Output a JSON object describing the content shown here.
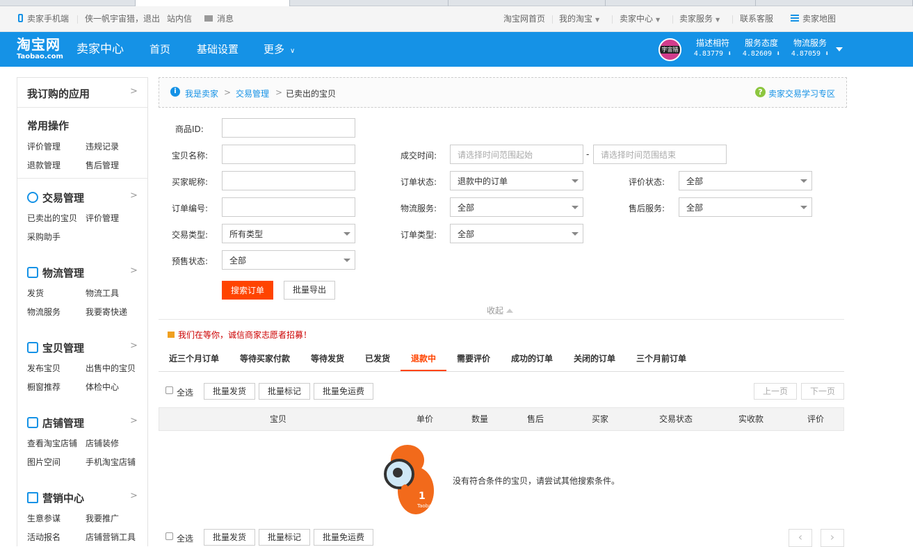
{
  "top_bar": {
    "mobile": "卖家手机端",
    "user": "侠一帆宇宙猎，退出",
    "inbox": "站内信",
    "messages": "消息",
    "taobao_home": "淘宝网首页",
    "my_taobao": "我的淘宝",
    "seller_center": "卖家中心",
    "seller_service": "卖家服务",
    "contact": "联系客服",
    "site_map": "卖家地图"
  },
  "header": {
    "logo_cn": "淘宝网",
    "logo_en": "Taobao.com",
    "title": "卖家中心",
    "nav": [
      "首页",
      "基础设置",
      "更多"
    ],
    "avatar_text": "宇宙猎",
    "stats": [
      {
        "label": "描述相符",
        "value": "4.83779"
      },
      {
        "label": "服务态度",
        "value": "4.82609"
      },
      {
        "label": "物流服务",
        "value": "4.87059"
      }
    ]
  },
  "sidebar": {
    "apps": "我订购的应用",
    "common": {
      "title": "常用操作",
      "links": [
        "评价管理",
        "违规记录",
        "退款管理",
        "售后管理"
      ]
    },
    "trade": {
      "title": "交易管理",
      "links": [
        "已卖出的宝贝",
        "评价管理",
        "采购助手"
      ]
    },
    "logistics": {
      "title": "物流管理",
      "links": [
        "发货",
        "物流工具",
        "物流服务",
        "我要寄快递"
      ]
    },
    "goods": {
      "title": "宝贝管理",
      "links": [
        "发布宝贝",
        "出售中的宝贝",
        "橱窗推荐",
        "体检中心"
      ]
    },
    "shop": {
      "title": "店铺管理",
      "links": [
        "查看淘宝店铺",
        "店铺装修",
        "图片空间",
        "手机淘宝店铺"
      ]
    },
    "marketing": {
      "title": "营销中心",
      "links": [
        "生意参谋",
        "我要推广",
        "活动报名",
        "店铺营销工具"
      ]
    }
  },
  "breadcrumb": {
    "items": [
      "我是卖家",
      "交易管理",
      "已卖出的宝贝"
    ],
    "separator": ">",
    "help": "卖家交易学习专区"
  },
  "form": {
    "item_id": "商品ID:",
    "item_name": "宝贝名称:",
    "buyer_nick": "买家昵称:",
    "order_no": "订单编号:",
    "trade_type": "交易类型:",
    "presale": "预售状态:",
    "deal_time": "成交时间:",
    "order_status": "订单状态:",
    "logistics": "物流服务:",
    "order_type": "订单类型:",
    "review_status": "评价状态:",
    "after_sale": "售后服务:",
    "time_start_ph": "请选择时间范围起始",
    "time_end_ph": "请选择时间范围结束",
    "dash": "-",
    "trade_type_val": "所有类型",
    "presale_val": "全部",
    "order_status_val": "退款中的订单",
    "logistics_val": "全部",
    "order_type_val": "全部",
    "review_status_val": "全部",
    "after_sale_val": "全部",
    "search_btn": "搜索订单",
    "export_btn": "批量导出",
    "collapse": "收起"
  },
  "notice": "我们在等你，诚信商家志愿者招募！",
  "tabs": [
    "近三个月订单",
    "等待买家付款",
    "等待发货",
    "已发货",
    "退款中",
    "需要评价",
    "成功的订单",
    "关闭的订单",
    "三个月前订单"
  ],
  "active_tab": "退款中",
  "toolbar": {
    "select_all": "全选",
    "batch_ship": "批量发货",
    "batch_mark": "批量标记",
    "batch_free": "批量免运费",
    "prev": "上一页",
    "next": "下一页"
  },
  "table": {
    "columns": [
      "宝贝",
      "单价",
      "数量",
      "售后",
      "买家",
      "交易状态",
      "实收款",
      "评价"
    ],
    "empty": "没有符合条件的宝贝，请尝试其他搜索条件。",
    "mascot_text": "Taobao"
  },
  "pager": {
    "prev": "‹",
    "next": "›"
  },
  "colors": {
    "brand_blue": "#1592e6",
    "search_orange": "#ff4400",
    "active_tab": "#ff4400",
    "notice_red": "#cc0000"
  }
}
